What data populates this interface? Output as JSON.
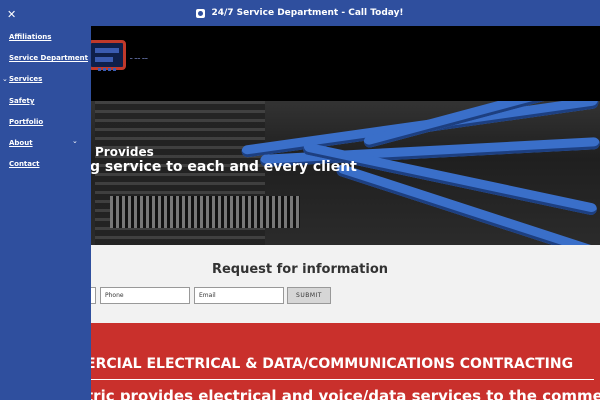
{
  "topbar": {
    "text": "24/7 Service Department - Call Today!",
    "icon": "phone-icon"
  },
  "sidebar": {
    "close_icon": "close-icon",
    "items": [
      {
        "label": "Affiliations"
      },
      {
        "label": "Service Department"
      },
      {
        "label": "Services"
      },
      {
        "label": "Safety"
      },
      {
        "label": "Portfolio"
      },
      {
        "label": "About"
      },
      {
        "label": "Contact"
      }
    ]
  },
  "hero": {
    "line1": "Provides",
    "line2": "g service to each and every client"
  },
  "request": {
    "title": "Request for information",
    "phone_placeholder": "Phone",
    "email_placeholder": "Email",
    "submit_label": "SUBMIT"
  },
  "redband": {
    "heading": "ERCIAL ELECTRICAL & DATA/COMMUNICATIONS CONTRACTING",
    "body": "tric provides electrical and voice/data services to the commercial"
  },
  "colors": {
    "nav_blue": "#2f4f9e",
    "accent_red": "#c9302c",
    "cable_blue": "#3a6fc9"
  }
}
